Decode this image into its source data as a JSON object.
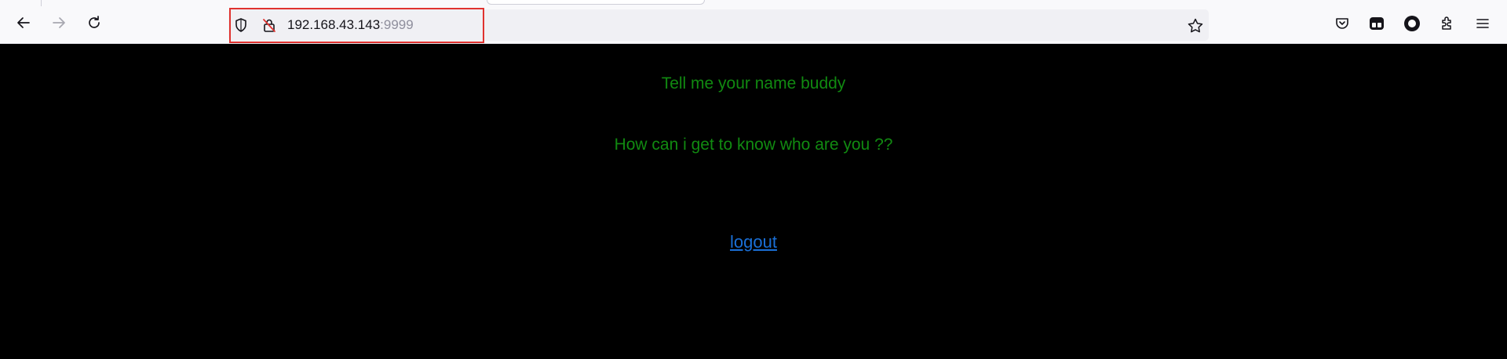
{
  "browser": {
    "url_host": "192.168.43.143",
    "url_port": ":9999",
    "icons": {
      "back": "back-arrow-icon",
      "forward": "forward-arrow-icon",
      "reload": "reload-icon",
      "tracking_shield": "shield-icon",
      "insecure_lock": "insecure-lock-icon",
      "bookmark": "star-icon",
      "pocket": "pocket-icon",
      "extension_a": "extension-icon",
      "profile": "profile-circle-icon",
      "extensions": "puzzle-icon",
      "menu": "hamburger-menu-icon"
    },
    "highlight_color": "#e0322f"
  },
  "page": {
    "heading": "Tell me your name buddy",
    "subtext": "How can i get to know who are you ??",
    "logout_label": "logout",
    "text_color": "#118a11",
    "link_color": "#1a6fd6",
    "background": "#000000"
  }
}
